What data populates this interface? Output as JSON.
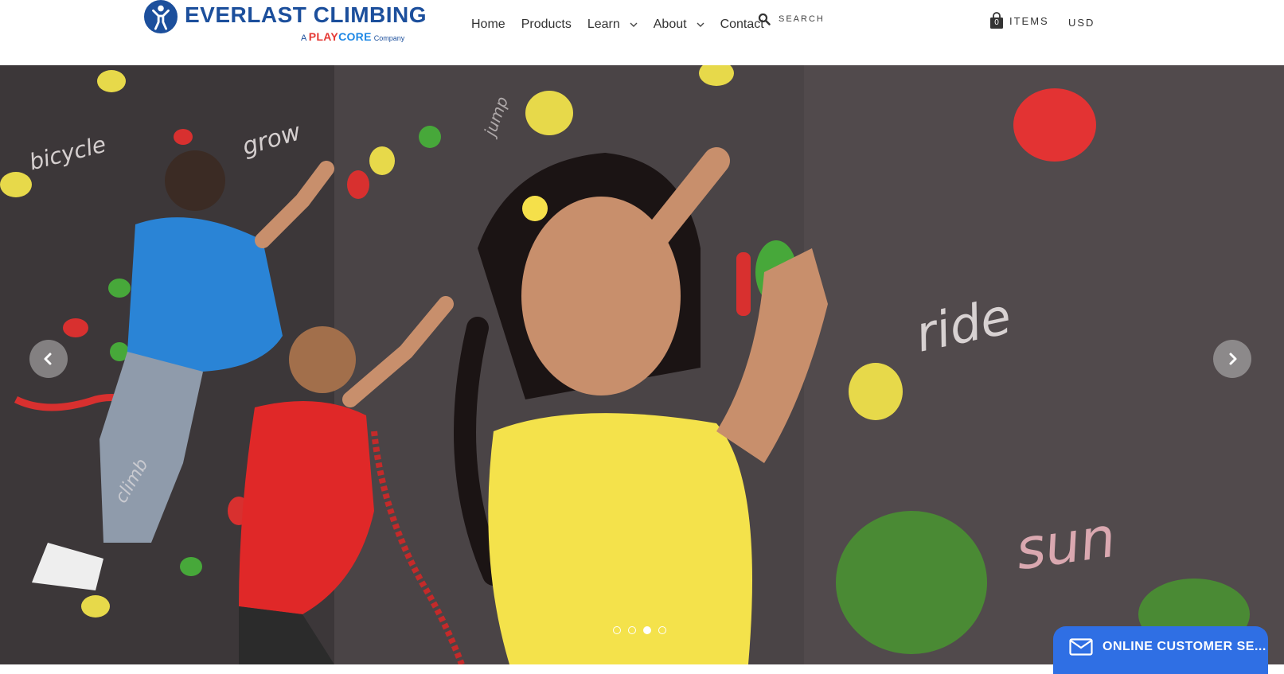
{
  "brand": {
    "name": "EVERLAST CLIMBING",
    "tagline_prefix": "A",
    "tagline_play": "PLAY",
    "tagline_core": "CORE",
    "tagline_suffix": "Company",
    "primary_color": "#1c4f9c"
  },
  "nav": {
    "items": [
      {
        "label": "Home",
        "has_dropdown": false
      },
      {
        "label": "Products",
        "has_dropdown": false
      },
      {
        "label": "Learn",
        "has_dropdown": true
      },
      {
        "label": "About",
        "has_dropdown": true
      },
      {
        "label": "Contact",
        "has_dropdown": false
      }
    ]
  },
  "search": {
    "placeholder": "SEARCH",
    "icon": "search-icon"
  },
  "cart": {
    "count": "0",
    "label": "ITEMS",
    "icon": "shopping-bag-icon"
  },
  "currency": {
    "label": "USD"
  },
  "hero": {
    "chalk_words": [
      "bicycle",
      "grow",
      "jump",
      "ride",
      "sun",
      "climb"
    ],
    "slides_total": 4,
    "active_slide": 3,
    "prev_icon": "chevron-left-icon",
    "next_icon": "chevron-right-icon"
  },
  "chat": {
    "label": "ONLINE CUSTOMER SE...",
    "icon": "envelope-icon",
    "color": "#2f6fe4"
  }
}
